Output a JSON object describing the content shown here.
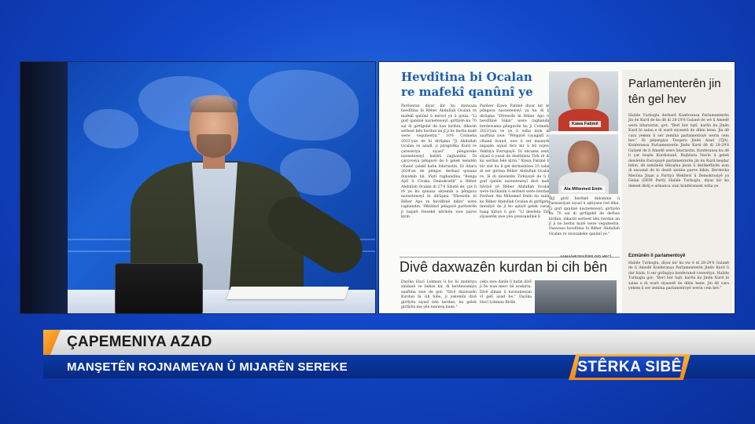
{
  "newspaper": {
    "headline_main": "Hevdîtina bi Ocalan re mafekî qanûnî ye",
    "headline_secondary": "Divê daxwazên kurdan bi cih bên",
    "sidebar_title": "Parlamenterên jin tên gel hev",
    "sidebar_subheading": "Ezmûnên li parlamentoyê",
    "photo_caption_1": "Kawa Fatimê",
    "photo_caption_2": "Ala Mihemed Emîn",
    "credit": "ANHA/HESEKÊ/BILIND HECÎ",
    "col1_text": "Parêzeran diyar kir ku daxwaza hevdîtina bi Rêber Abdullah Ocalan re mafekî qanûnî û mirovî ye û gotin: \"Li gorî qanûnê navneteweyî, girtîyên ku 70 sal di girtîgehê de ban kiribin, dikarin serbest bên berdan an jî ji bo herba malê were veguhestin.\" 10'ê Cotmeha 2023'yan de bi dirûşma \"Ji Abdullah Ocalan re azadî, ji pirsgirêka Kurd re çareseriya siyasî\" pêngaveke navneteweyî hatibû raghandin. Di çarçoveya pêngavê de li gelek welatên cîhanê çalakî hatin lidarxistin. Di Adara 2024'an de pêngav derbasî qonaxa duyemîn bû. Piştî raghandina \"Banga Aştî û Civaka Demokratîk\" a Rêber Abdullah Ocalan di 27'ê Sibatê de, çav li rê ye ku qonaxa sêyemîn a pêngava navneteweyî bi dirûşma \"Dîrewzîn bi Rêber Apo re hevdîtinê bikin\" were raghandin. Têkildarî pêngavê parêzerên ji bajarê Hesekê nêrînên xwe parve kirin.",
    "col2_text": "Parêzer Kawa Fatimê diyar kir ku pêngava navneteweyî ya ku di bi dirûşma \"Dîrewzîn bi Rêber Apo re hevdîtinê bikin\" were raghandin berdewama pêngavên ku ji Cotmeha 2023'yan ve ye û wiha dom da axaftina xwe: \"Pêngavê rayagiştî ya cîhanê livand, xwe li ser maseyên nîqaşên siyasî ferz kir û bû rojeva Yekîtiya Ewropayê. Di encama zexta siyasî û yasal de desthilata Tirk rê da ku serdan bên kirin.\" Kawa Fatimê bi bîr xist ku li gel derbasbûna 25 salan di ser girtina Rêber Abdullah Ocalan re, lê di dewletên Tirkiyeyê de û li gorî qanûn navneteweyî divê mafê hêvîyê yê Rêber Abdullah Ocalan were bicîhanîn û serbest were berdan. Parêzer Ala Mihemed Emîn da zanîn ku Rêber Abdullah Ocalan di girtîgeha îmraliyê de ji bo aştiyê gelek caran bang kiriye û got: \"Li dewleta Tirk sîyasetên xwe yên çewisandinê li",
    "col3_text": "dijî girtî herêmê didomîne û çareseriyan siyasî û aştiyane red dike. Li gorî qanûnê navneteweyî, girtiyên ku 70 sal di girtîgehê de derbas kiribin, dikarin serbest bên berdan an jî ji bo herba malê were veguhestin. Daxwaza hevdîtina bi Rêber Abdullah Ocalan re xwezakeke qanûnî ye.\"",
    "sidebar_text": "Halide Turkoglu derbarê Konferansa Parlamenterên Jin ên Kurd de ku dê di 28-29'ê Gulanê de wê li Amedê were lidarxistin, got: \"Berî her tiştî, karên ku Jinên Kurd bi salan e di warê siyasetê de dikin hene. Jin dê cara yekem li ser zemîna parlamentoyê werin cem hev.\" Bi pêşengiya Tevgera Jinên Azad (TJA), Konferansa Parlamenterên Jinên Kurd dê di 28-29'ê Gulanê de li Amedê were lidarxistin. Konferansa ku dê li çar beşên Kurdistanê, Rojhilata Navîn û gelek dewletên Ewropayê parlamenterên jin ên Kurd beşdar bibin, dê ezmûnên têkoşîna jinan û destkeftiyên wan di encamê de bi destê xistine parve bikin. Berdevka Meclisa Jinan a Partiya Wekhevî û Demokrasiyê ya Gelan (DEM Partî) Halide Turkoglu, diyar kir ku demek dirêj e armanca wan konferansek wiha ye.",
    "sidebar_text_2": "Halide Turkoglu, diyar kir ku ew ê di 28-29'ê Gulanê de li Amedê Konferansa Parlamenterên Jinên Kurd li dar bixin, li ser girîngiya konferansê rawestiya. Halide Turkoglu got: \"Berî her tiştî, karên ku Jinên Kurd bi salan e di warê siyasetê de dikin hene. Jin dê cara yekem li ser zemîna parlamentoyê werin cem hev.\"",
    "col4_text": "Dayika Hacî Lokman li ku bi mafetiya zindanê ve behse kir, di berdewamiya axaftina xwe de got: \"Divê daxwazên Kurdan bi cih bibe, ji yekemîn divê girtîyên siyasî bên berdan, ku gelek girtîyên me yên nexweş hene.\"",
    "col5_text": "çeka xwe danîn û hatin divê ji bo wan merc bê avakirin. Divê zîman û navnameyan vî gelî azad be.\" Dayika Hacî Lokman Birlik"
  },
  "lower_third": {
    "title": "ÇAPEMENIYA AZAD",
    "subtitle": "MANŞETÊN ROJNAMEYAN Û MIJARÊN SEREKE"
  },
  "logo": {
    "text": "STÊRKA SIBÊ"
  },
  "colors": {
    "background": "#1147c8",
    "accent_orange": "#f08b16",
    "headline_blue": "#1f5fae",
    "lower_third_blue": "#0a3aa6"
  }
}
